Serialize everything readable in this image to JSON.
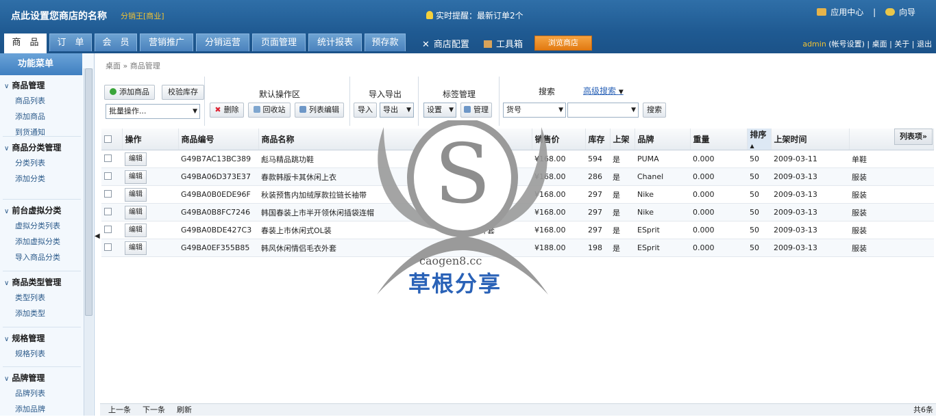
{
  "header": {
    "site_title": "点此设置您商店的名称",
    "edition": "分销王[商业]",
    "notice": "实时提醒：最新订单2个",
    "app_center": "应用中心",
    "guide": "向导",
    "separator": "|"
  },
  "tabs": [
    "商　品",
    "订　单",
    "会　员",
    "营销推广",
    "分销运营",
    "页面管理",
    "统计报表",
    "预存款"
  ],
  "tools": {
    "store_config": "商店配置",
    "toolbox": "工具箱",
    "browse_store": "浏览商店"
  },
  "admin": {
    "user": "admin",
    "account": "(帐号设置)",
    "links": "| 桌面 | 关于 | 退出"
  },
  "sidebar": {
    "title": "功能菜单",
    "groups": [
      {
        "title": "商品管理",
        "items": [
          "商品列表",
          "添加商品",
          "到货通知"
        ]
      },
      {
        "title": "商品分类管理",
        "items": [
          "分类列表",
          "添加分类"
        ]
      },
      {
        "title": "前台虚拟分类",
        "items": [
          "虚拟分类列表",
          "添加虚拟分类",
          "导入商品分类"
        ]
      },
      {
        "title": "商品类型管理",
        "items": [
          "类型列表",
          "添加类型"
        ]
      },
      {
        "title": "规格管理",
        "items": [
          "规格列表"
        ]
      },
      {
        "title": "品牌管理",
        "items": [
          "品牌列表",
          "添加品牌"
        ]
      }
    ]
  },
  "breadcrumb": [
    "桌面",
    "»",
    "商品管理"
  ],
  "toolbar": {
    "add_goods": "添加商品",
    "check_stock": "校验库存",
    "batch_ops": "批量操作...",
    "default_area": "默认操作区",
    "delete": "删除",
    "recycle": "回收站",
    "list_edit": "列表编辑",
    "import_export": "导入导出",
    "import": "导入",
    "export": "导出",
    "tag_mgmt": "标签管理",
    "settings": "设置",
    "manage": "管理",
    "search_title": "搜索",
    "advanced_search": "高级搜索",
    "search_field": "货号",
    "search_btn": "搜索"
  },
  "grid": {
    "columns": [
      "操作",
      "商品编号",
      "商品名称",
      "分类",
      "销售价",
      "库存",
      "上架",
      "品牌",
      "重量",
      "排序",
      "上架时间",
      ""
    ],
    "column_options": "列表项»",
    "edit_label": "编辑",
    "rows": [
      [
        "G49B7AC13BC389",
        "彪马精品跳功鞋",
        "运动休闲",
        "¥168.00",
        "594",
        "是",
        "PUMA",
        "0.000",
        "50",
        "2009-03-11",
        "单鞋"
      ],
      [
        "G49BA06D373E37",
        "春款韩版卡其休闲上衣",
        "外套",
        "¥168.00",
        "286",
        "是",
        "Chanel",
        "0.000",
        "50",
        "2009-03-13",
        "服装"
      ],
      [
        "G49BA0B0EDE96F",
        "秋装预售内加绒厚款拉链长袖带",
        "外套",
        "¥168.00",
        "297",
        "是",
        "Nike",
        "0.000",
        "50",
        "2009-03-13",
        "服装"
      ],
      [
        "G49BA0B8FC7246",
        "韩国春装上市半开领休闲插袋连帽",
        "外套",
        "¥168.00",
        "297",
        "是",
        "Nike",
        "0.000",
        "50",
        "2009-03-13",
        "服装"
      ],
      [
        "G49BA0BDE427C3",
        "春装上市休闲式OL装",
        "外套",
        "¥168.00",
        "297",
        "是",
        "ESprit",
        "0.000",
        "50",
        "2009-03-13",
        "服装"
      ],
      [
        "G49BA0EF355B85",
        "韩风休闲情侣毛衣外套",
        "外套",
        "¥188.00",
        "198",
        "是",
        "ESprit",
        "0.000",
        "50",
        "2009-03-13",
        "服装"
      ]
    ]
  },
  "statusbar": {
    "prev": "上一条",
    "next": "下一条",
    "refresh": "刷新",
    "total": "共6条"
  },
  "watermark": {
    "site": "caogen8.cc",
    "name": "草根分享"
  },
  "colors": {
    "header": "#1f5a92",
    "accent": "#e27a12",
    "link": "#2a62b7"
  }
}
